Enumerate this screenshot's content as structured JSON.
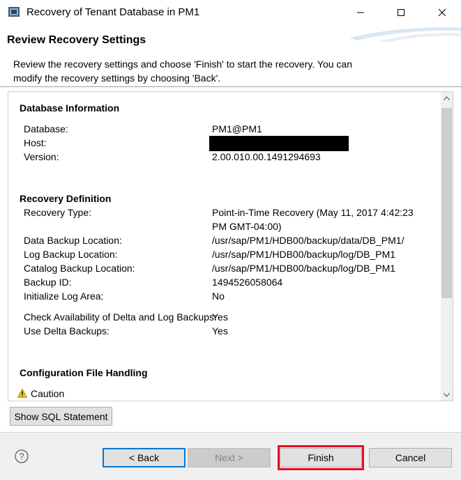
{
  "window": {
    "title": "Recovery of Tenant Database in PM1"
  },
  "header": {
    "title": "Review Recovery Settings",
    "description": "Review the recovery settings and choose 'Finish' to start the recovery. You can modify the recovery settings by choosing 'Back'."
  },
  "database_info": {
    "section_title": "Database Information",
    "rows": [
      {
        "label": "Database:",
        "value": "PM1@PM1"
      },
      {
        "label": "Host:",
        "value": ""
      },
      {
        "label": "Version:",
        "value": "2.00.010.00.1491294693"
      }
    ]
  },
  "recovery_definition": {
    "section_title": "Recovery Definition",
    "recovery_type_label": "Recovery Type:",
    "recovery_type_value_line1": "Point-in-Time Recovery (May 11, 2017 4:42:23",
    "recovery_type_value_line2": "PM GMT-04:00)",
    "rows": [
      {
        "label": "Data Backup Location:",
        "value": "/usr/sap/PM1/HDB00/backup/data/DB_PM1/"
      },
      {
        "label": "Log Backup Location:",
        "value": "/usr/sap/PM1/HDB00/backup/log/DB_PM1"
      },
      {
        "label": "Catalog Backup Location:",
        "value": "/usr/sap/PM1/HDB00/backup/log/DB_PM1"
      },
      {
        "label": "Backup ID:",
        "value": "1494526058064"
      },
      {
        "label": "Initialize Log Area:",
        "value": "No"
      }
    ],
    "check_availability_label": "Check Availability of Delta and Log Backups:",
    "check_availability_value": "Yes",
    "use_delta_label": "Use Delta Backups:",
    "use_delta_value": "Yes"
  },
  "config_file": {
    "section_title": "Configuration File Handling",
    "caution_label": "Caution"
  },
  "buttons": {
    "show_sql": "Show SQL Statement",
    "back": "< Back",
    "next": "Next >",
    "finish": "Finish",
    "cancel": "Cancel"
  },
  "icons": {
    "app": "database-recovery-icon",
    "minimize": "minimize-icon",
    "maximize": "maximize-icon",
    "close": "close-icon",
    "help": "help-icon",
    "caution": "warning-icon"
  },
  "colors": {
    "finish_highlight": "#e81123",
    "default_button_border": "#0078d7",
    "caution_yellow": "#f2c811"
  }
}
